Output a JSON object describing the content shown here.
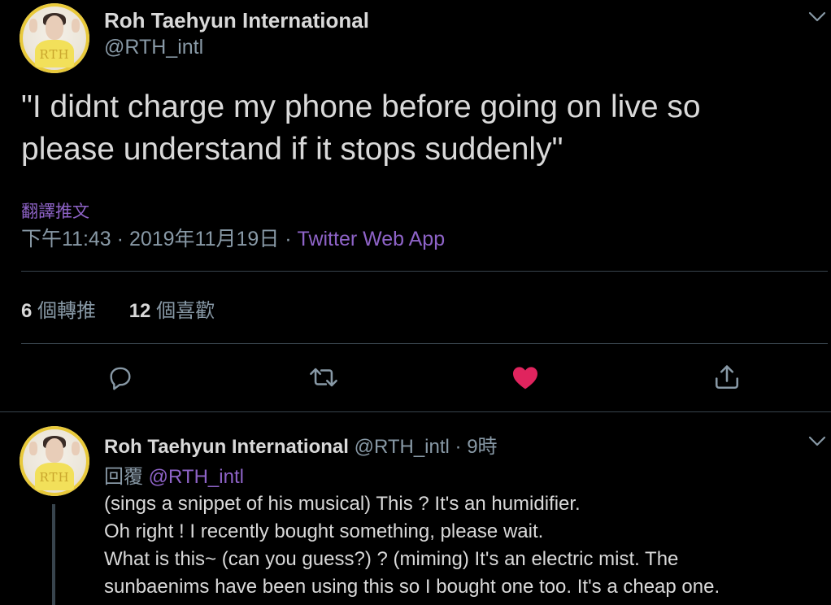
{
  "main_tweet": {
    "author_name": "Roh Taehyun International",
    "author_handle": "@RTH_intl",
    "avatar_text": "RTH",
    "text_line1": "\"I didnt charge my phone before going on live so",
    "text_line2": "please understand if it stops suddenly\"",
    "translate_label": "翻譯推文",
    "time": "下午11:43",
    "separator": " · ",
    "date": "2019年11月19日",
    "source": "Twitter Web App",
    "retweet_count": "6",
    "retweet_label": "個轉推",
    "like_count": "12",
    "like_label": "個喜歡",
    "liked": true
  },
  "actions": {
    "reply_icon": "reply-icon",
    "retweet_icon": "retweet-icon",
    "like_icon": "heart-icon",
    "share_icon": "share-icon"
  },
  "reply_tweet": {
    "author_name": "Roh Taehyun International",
    "author_handle": "@RTH_intl",
    "separator": "·",
    "time": "9時",
    "avatar_text": "RTH",
    "replying_label": "回覆",
    "replying_to": "@RTH_intl",
    "lines": [
      "(sings a snippet of his musical) This ? It's an humidifier.",
      "Oh right ! I recently bought something, please wait.",
      "What is this~ (can you guess?) ? (miming) It's an electric mist. The",
      "sunbaenims have been using this so I bought one too. It's a cheap one."
    ]
  },
  "colors": {
    "background": "#000000",
    "text": "#d9d9d9",
    "muted": "#8899a6",
    "accent": "#8e63c7",
    "like": "#e0245e",
    "divider": "#38444d"
  }
}
